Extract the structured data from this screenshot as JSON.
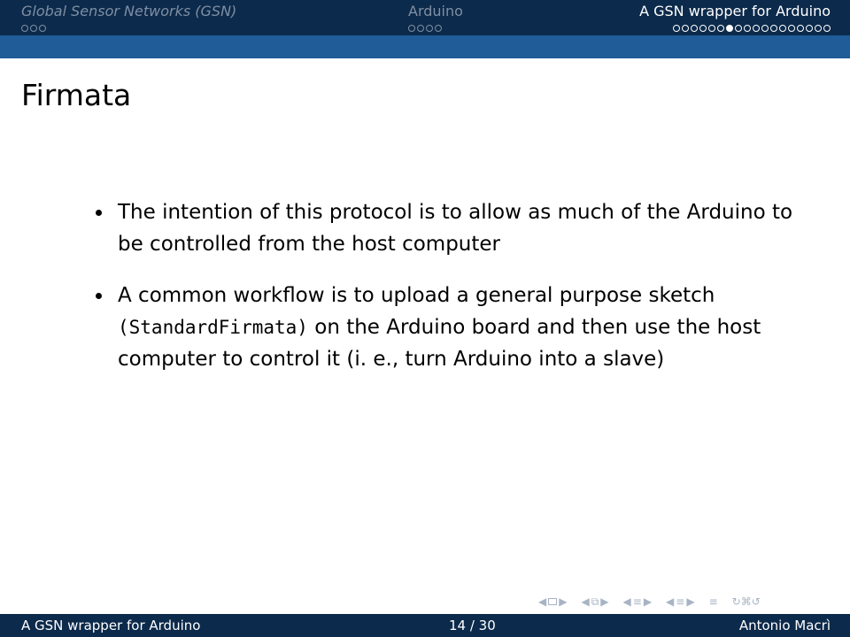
{
  "header": {
    "sections": [
      {
        "title": "Global Sensor Networks (GSN)",
        "dots": 3,
        "current": -1,
        "active": false
      },
      {
        "title": "Arduino",
        "dots": 4,
        "current": -1,
        "active": false
      },
      {
        "title": "A GSN wrapper for Arduino",
        "dots": 18,
        "current": 6,
        "active": true
      }
    ]
  },
  "frame": {
    "title": "Firmata",
    "items": [
      {
        "text": "The intention of this protocol is to allow as much of the Arduino to be controlled from the host computer"
      },
      {
        "before": "A common workflow is to upload a general purpose sketch",
        "code": "(StandardFirmata)",
        "after": "on the Arduino board and then use the host computer to control it (i. e., turn Arduino into a slave)"
      }
    ]
  },
  "nav_symbols": [
    "slide-nav-icon",
    "frame-nav-icon",
    "subsection-nav-icon",
    "section-nav-icon",
    "align-icon",
    "search-icon"
  ],
  "footer": {
    "title": "A GSN wrapper for Arduino",
    "page": "14 / 30",
    "author": "Antonio Macrì"
  },
  "colors": {
    "headline_bg": "#0c2a4b",
    "subline_bg": "#1f5c98",
    "inactive_text": "#7f8ea3",
    "active_text": "#ffffff"
  }
}
